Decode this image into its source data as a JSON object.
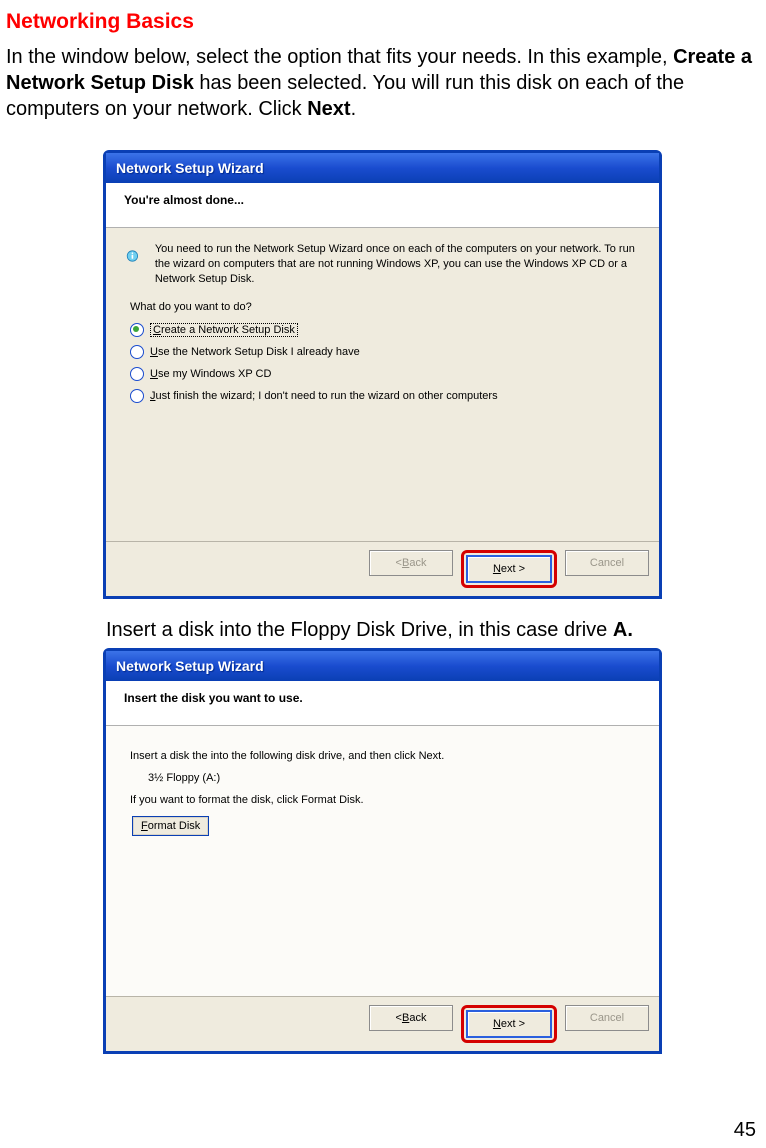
{
  "doc": {
    "heading": "Networking Basics",
    "p1_a": "In the window below, select the option that fits your needs. In this example, ",
    "p1_b": "Create a Network Setup Disk",
    "p1_c": " has been selected.  You will run this disk on each of the computers on your network. Click ",
    "p1_d": "Next",
    "p1_e": ".",
    "caption_a": "Insert a disk into the Floppy Disk Drive, in this case drive ",
    "caption_b": "A.",
    "page_number": "45"
  },
  "wiz1": {
    "title": "Network Setup Wizard",
    "header": "You're almost done...",
    "info": "You need to run the Network Setup Wizard once on each of the computers on your network. To run the wizard on computers that are not running Windows XP, you can use the Windows XP CD or a Network Setup Disk.",
    "question": "What do you want to do?",
    "opt1_pre": "C",
    "opt1_rest": "reate a Network Setup Disk",
    "opt2_pre": "U",
    "opt2_rest": "se the Network Setup Disk I already have",
    "opt3_pre": "U",
    "opt3_rest": "se my Windows XP CD",
    "opt4_pre": "J",
    "opt4_rest": "ust finish the wizard; I don't need to run the wizard on other computers",
    "back_pre": "< ",
    "back_u": "B",
    "back_rest": "ack",
    "next_u": "N",
    "next_rest": "ext >",
    "cancel": "Cancel"
  },
  "wiz2": {
    "title": "Network Setup Wizard",
    "header": "Insert the disk you want to use.",
    "line1": "Insert a disk the into the following disk drive, and then click Next.",
    "drive": "3½ Floppy (A:)",
    "line2": "If you want to format the disk, click Format Disk.",
    "fmt_u": "F",
    "fmt_rest": "ormat Disk",
    "back_pre": "< ",
    "back_u": "B",
    "back_rest": "ack",
    "next_u": "N",
    "next_rest": "ext >",
    "cancel": "Cancel"
  }
}
